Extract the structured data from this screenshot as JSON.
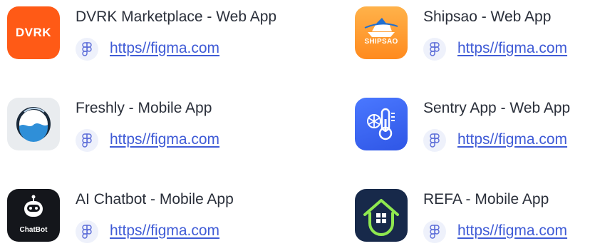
{
  "apps": [
    {
      "title": "DVRK Marketplace - Web App",
      "link": "https//figma.com",
      "icon": "dvrk-logo-icon",
      "icon_text": "DVRK",
      "color": "#ff5a16"
    },
    {
      "title": "Shipsao - Web App",
      "link": "https//figma.com",
      "icon": "shipsao-logo-icon",
      "icon_text": "SHIPSAO",
      "color": "#ff9a2e"
    },
    {
      "title": "Freshly - Mobile App",
      "link": "https//figma.com",
      "icon": "freshly-logo-icon",
      "color": "#2f8fd8"
    },
    {
      "title": "Sentry App - Web App",
      "link": "https//figma.com",
      "icon": "sentry-thermometer-icon",
      "color": "#3d66f2"
    },
    {
      "title": "AI Chatbot - Mobile App",
      "link": "https//figma.com",
      "icon": "chatbot-robot-icon",
      "icon_text": "ChatBot",
      "color": "#14161b"
    },
    {
      "title": "REFA - Mobile App",
      "link": "https//figma.com",
      "icon": "refa-house-icon",
      "color": "#17294a"
    }
  ],
  "link_color": "#3f5bd6"
}
